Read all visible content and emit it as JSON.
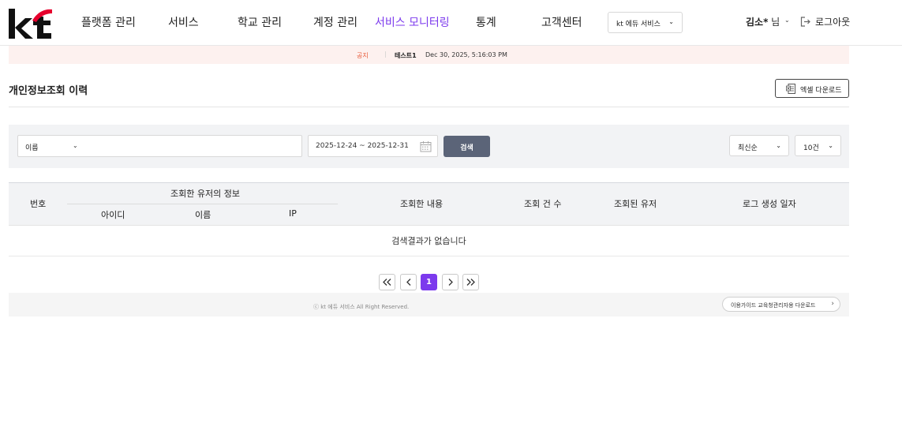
{
  "header": {
    "logo_alt": "kt",
    "nav": [
      {
        "label": "플랫폼 관리"
      },
      {
        "label": "서비스"
      },
      {
        "label": "학교 관리"
      },
      {
        "label": "계정 관리"
      },
      {
        "label": "서비스 모니터링",
        "active": true
      },
      {
        "label": "통계"
      },
      {
        "label": "고객센터"
      }
    ],
    "org_select": "kt 에듀 서비스",
    "user_name": "김소*",
    "user_suffix": " 님",
    "logout_label": "로그아웃"
  },
  "notice": {
    "tag": "공지",
    "separator": "|",
    "title": "테스트1",
    "date": "Dec 30, 2025, 5:16:03 PM"
  },
  "page": {
    "title": "개인정보조회 이력",
    "excel_button": "엑셀 다운로드"
  },
  "search": {
    "field_select": "이름",
    "keyword_value": "",
    "date_range": "2025-12-24 ~ 2025-12-31",
    "search_button": "검색",
    "sort_select": "최신순",
    "page_size_select": "10건"
  },
  "table": {
    "col_no": "번호",
    "group_user_info": "조회한 유저의 정보",
    "col_id": "아이디",
    "col_name": "이름",
    "col_ip": "IP",
    "col_content": "조회한 내용",
    "col_count": "조회 건 수",
    "col_target_user": "조회된 유저",
    "col_log_date": "로그 생성 일자",
    "empty_message": "검색결과가 없습니다"
  },
  "pagination": {
    "current_page": "1"
  },
  "footer": {
    "copyright": "ⓒ kt 에듀 서비스 All Right Reserved.",
    "guide_button": "이용가이드 교육청관리자용 다운로드"
  },
  "colors": {
    "accent": "#7c3aed",
    "kt_red": "#e6002d",
    "notice_bg": "#fdf1ef",
    "search_btn": "#5b6478"
  }
}
